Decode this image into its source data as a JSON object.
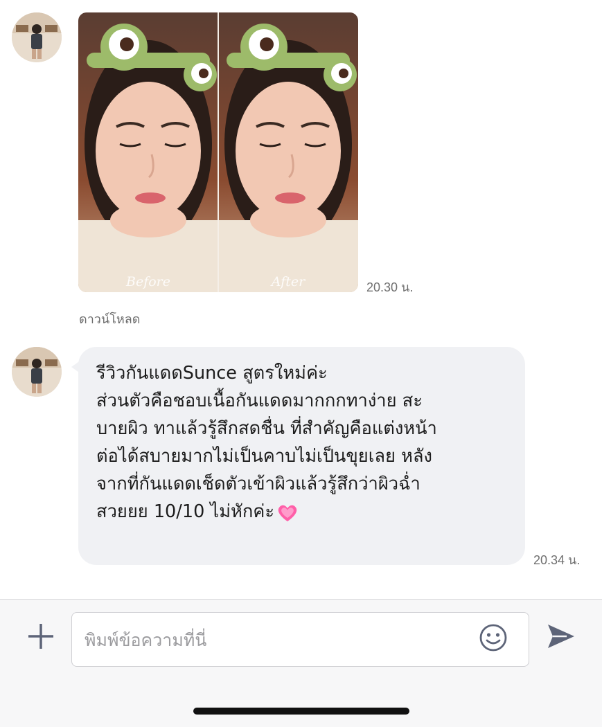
{
  "conversation": {
    "messages": [
      {
        "type": "image",
        "labels": [
          "Before",
          "After"
        ],
        "time": "20.30 น.",
        "download_label": "ดาวน์โหลด"
      },
      {
        "type": "text",
        "text": "รีวิวกันแดดSunce สูตรใหม่ค่ะ\nส่วนตัวคือชอบเนื้อกันแดดมากกกทาง่าย สะ\nบายผิว ทาแล้วรู้สึกสดชื่น ที่สำคัญคือแต่งหน้า\nต่อได้สบายมากไม่เป็นคาบไม่เป็นขุยเลย หลัง\nจากที่กันแดดเช็ดตัวเข้าผิวแล้วรู้สึกว่าผิวฉ่ำ\nสวยยย 10/10 ไม่หักค่ะ",
        "emoji": "pink-heart-icon",
        "time": "20.34 น."
      }
    ]
  },
  "composer": {
    "placeholder": "พิมพ์ข้อความที่นี่",
    "plus_icon": "plus-icon",
    "emoji_icon": "smiley-icon",
    "send_icon": "send-icon"
  },
  "colors": {
    "bubble": "#f0f1f4",
    "icon": "#5d6478",
    "heart": "#ff5fa8"
  }
}
